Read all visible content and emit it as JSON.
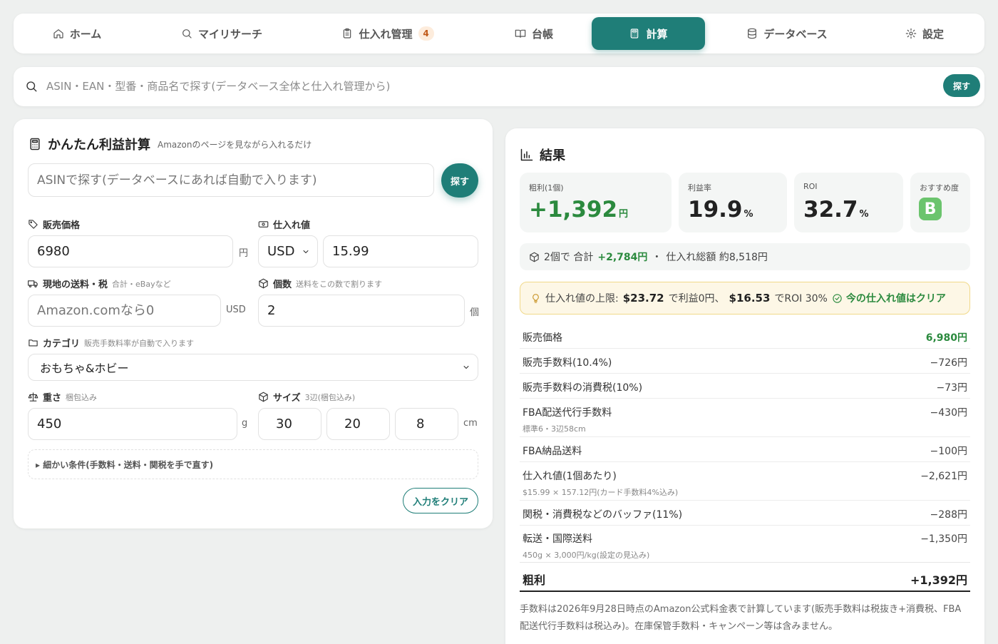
{
  "nav": {
    "home": "ホーム",
    "my_research": "マイリサーチ",
    "purchase_mgmt": "仕入れ管理",
    "purchase_badge": "4",
    "ledger": "台帳",
    "calc": "計算",
    "database": "データベース",
    "settings": "設定"
  },
  "global_search": {
    "placeholder": "ASIN・EAN・型番・商品名で探す(データベース全体と仕入れ管理から)",
    "button": "探す"
  },
  "calc": {
    "title": "かんたん利益計算",
    "subtitle": "Amazonのページを見ながら入れるだけ",
    "asin_placeholder": "ASINで探す(データベースにあれば自動で入ります)",
    "asin_button": "探す",
    "sale_price_label": "販売価格",
    "sale_price_value": "6980",
    "sale_price_unit": "円",
    "cost_label": "仕入れ値",
    "currency": "USD",
    "cost_value": "15.99",
    "local_ship_label": "現地の送料・税",
    "local_ship_hint": "合計・eBayなど",
    "local_ship_placeholder": "Amazon.comなら0",
    "local_ship_unit": "USD",
    "qty_label": "個数",
    "qty_hint": "送料をこの数で割ります",
    "qty_value": "2",
    "qty_unit": "個",
    "category_label": "カテゴリ",
    "category_hint": "販売手数料率が自動で入ります",
    "category_value": "おもちゃ&ホビー",
    "weight_label": "重さ",
    "weight_hint": "梱包込み",
    "weight_value": "450",
    "weight_unit": "g",
    "size_label": "サイズ",
    "size_hint": "3辺(梱包込み)",
    "size_a": "30",
    "size_b": "20",
    "size_c": "8",
    "size_unit": "cm",
    "details_toggle": "▸ 細かい条件(手数料・送料・関税を手で直す)",
    "clear_button": "入力をクリア"
  },
  "result": {
    "title": "結果",
    "profit_label": "粗利(1個)",
    "profit_value": "+1,392",
    "profit_unit": "円",
    "margin_label": "利益率",
    "margin_value": "19.9",
    "margin_unit": "%",
    "roi_label": "ROI",
    "roi_value": "32.7",
    "roi_unit": "%",
    "reco_label": "おすすめ度",
    "reco_grade": "B",
    "summary_prefix": "2個で 合計",
    "summary_total": "+2,784円",
    "summary_sep": "・",
    "summary_cost": "仕入れ総額 約8,518円",
    "alert_prefix": "仕入れ値の上限:",
    "alert_breakeven": "$23.72",
    "alert_mid": "で利益0円、",
    "alert_roi_price": "$16.53",
    "alert_roi": "でROI 30%",
    "alert_ok": "今の仕入れ値はクリア",
    "rows": [
      {
        "label": "販売価格",
        "value": "6,980円",
        "sub": ""
      },
      {
        "label": "販売手数料(10.4%)",
        "value": "−726円",
        "sub": ""
      },
      {
        "label": "販売手数料の消費税(10%)",
        "value": "−73円",
        "sub": ""
      },
      {
        "label": "FBA配送代行手数料",
        "value": "−430円",
        "sub": "標準6・3辺58cm"
      },
      {
        "label": "FBA納品送料",
        "value": "−100円",
        "sub": ""
      },
      {
        "label": "仕入れ値(1個あたり)",
        "value": "−2,621円",
        "sub": "$15.99 × 157.12円(カード手数料4%込み)"
      },
      {
        "label": "関税・消費税などのバッファ(11%)",
        "value": "−288円",
        "sub": ""
      },
      {
        "label": "転送・国際送料",
        "value": "−1,350円",
        "sub": "450g × 3,000円/kg(設定の見込み)"
      }
    ],
    "total_label": "粗利",
    "total_value": "+1,392円",
    "note": "手数料は2026年9月28日時点のAmazon公式料金表で計算しています(販売手数料は税抜き+消費税、FBA配送代行手数料は税込み)。在庫保管手数料・キャンペーン等は含みません。"
  }
}
